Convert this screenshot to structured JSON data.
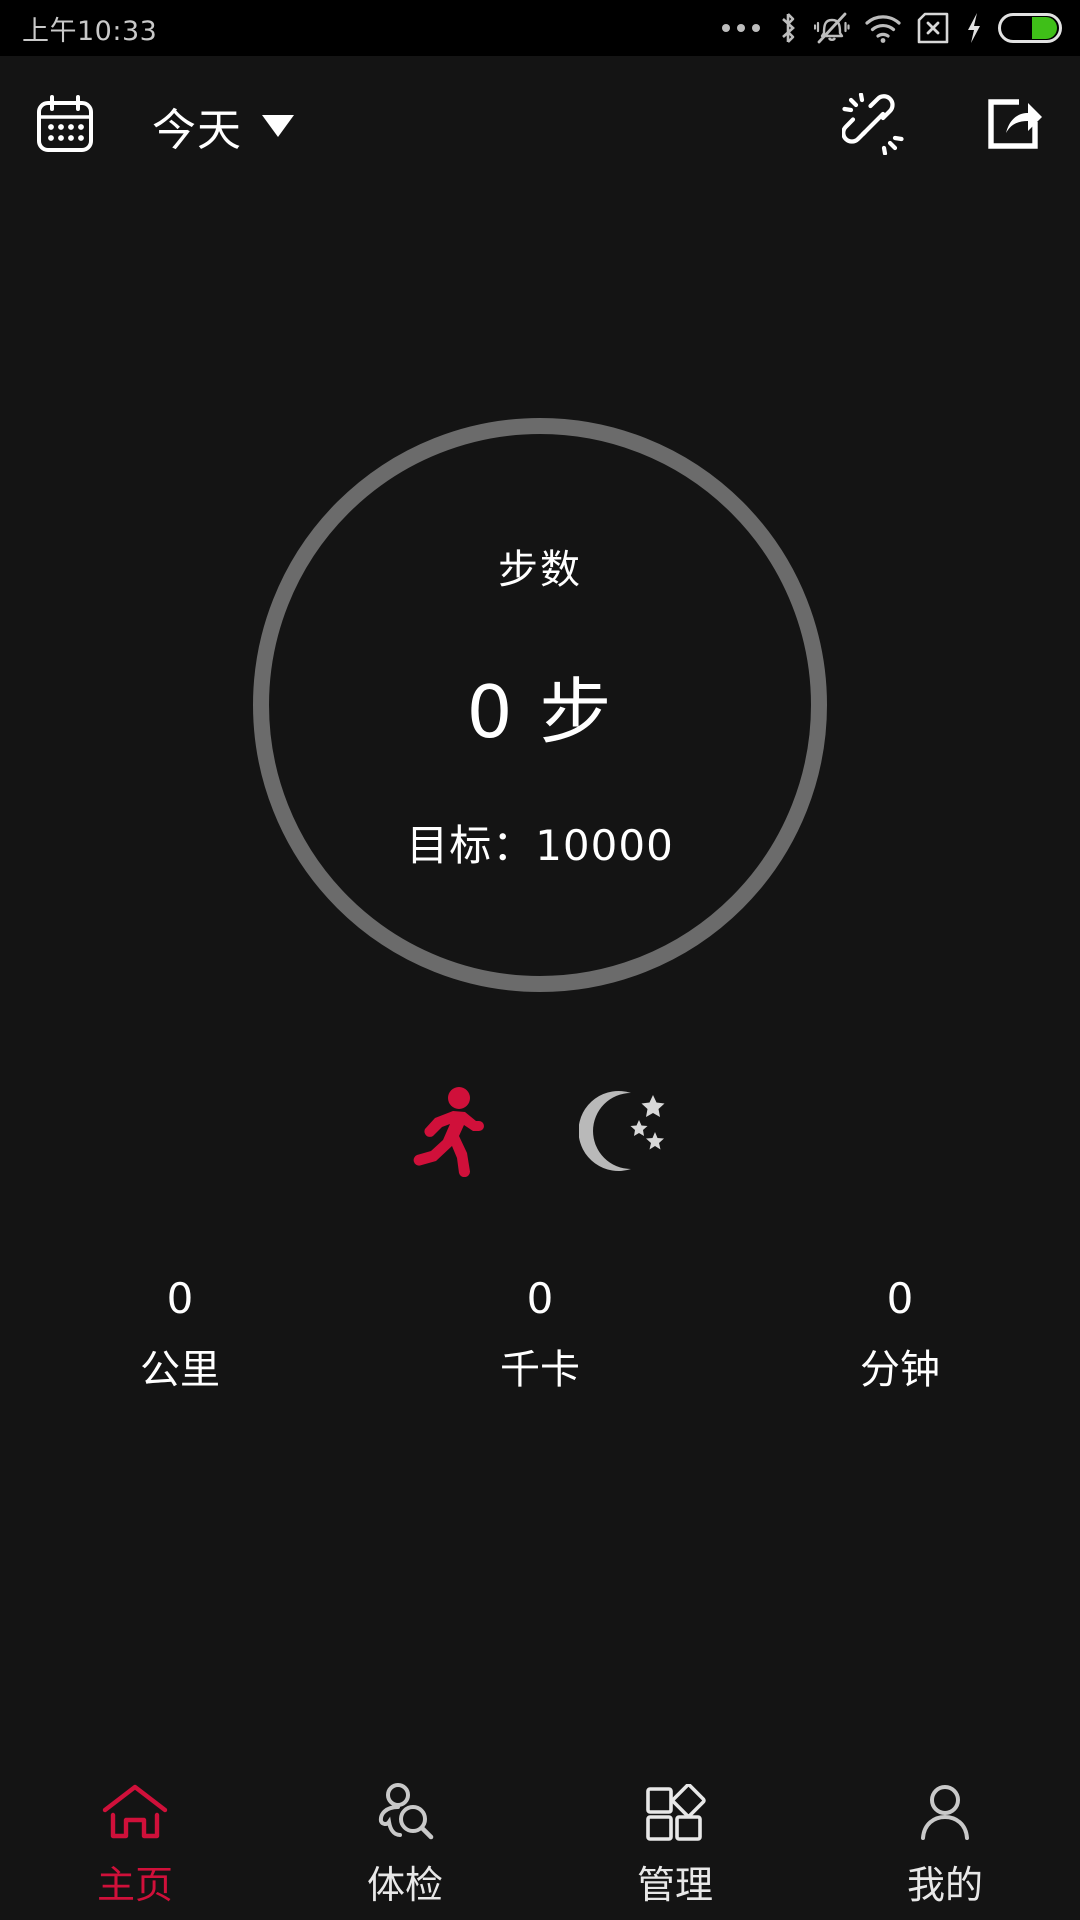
{
  "colors": {
    "background": "#141414",
    "statusbar_bg": "#000000",
    "accent_red": "#d0103a",
    "ring_track": "#6b6b6b",
    "text_primary": "#ffffff",
    "text_muted": "#c9c9c9",
    "battery_green": "#3fbf18"
  },
  "statusbar": {
    "time": "上午10:33",
    "icons": [
      "more-dots-icon",
      "bluetooth-icon",
      "silent-vibrate-off-icon",
      "wifi-icon",
      "sim-card-off-icon",
      "charging-bolt-icon",
      "battery-icon"
    ]
  },
  "appbar": {
    "calendar_icon": "calendar-icon",
    "date_label": "今天",
    "dropdown_icon": "chevron-down-icon",
    "link_icon": "broken-link-icon",
    "share_icon": "share-icon"
  },
  "ring": {
    "title": "步数",
    "value": "0 步",
    "goal": "目标：10000",
    "progress_percent": 0,
    "goal_number": 10000,
    "steps": 0
  },
  "modes": [
    {
      "name": "running-mode-icon",
      "label": "running",
      "active": true
    },
    {
      "name": "sleep-mode-icon",
      "label": "sleep",
      "active": false
    }
  ],
  "stats": [
    {
      "value": "0",
      "label": "公里"
    },
    {
      "value": "0",
      "label": "千卡"
    },
    {
      "value": "0",
      "label": "分钟"
    }
  ],
  "tabs": [
    {
      "label": "主页",
      "icon": "home-icon",
      "active": true
    },
    {
      "label": "体检",
      "icon": "health-check-icon",
      "active": false
    },
    {
      "label": "管理",
      "icon": "manage-grid-icon",
      "active": false
    },
    {
      "label": "我的",
      "icon": "profile-icon",
      "active": false
    }
  ]
}
